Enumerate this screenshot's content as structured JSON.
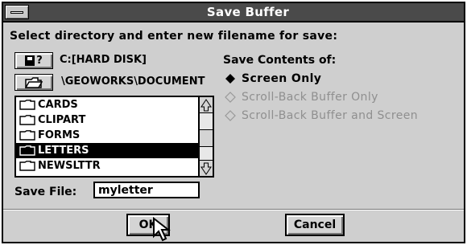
{
  "window": {
    "title": "Save Buffer"
  },
  "instructions": "Select directory and enter new filename for save:",
  "drive": {
    "button_label": "?",
    "label": "C:[HARD DISK]"
  },
  "path": {
    "label": "\\GEOWORKS\\DOCUMENT"
  },
  "file_list": {
    "items": [
      {
        "label": "CARDS",
        "selected": false
      },
      {
        "label": "CLIPART",
        "selected": false
      },
      {
        "label": "FORMS",
        "selected": false
      },
      {
        "label": "LETTERS",
        "selected": true
      },
      {
        "label": "NEWSLTTR",
        "selected": false
      }
    ]
  },
  "save_file": {
    "label": "Save File:",
    "value": "myletter"
  },
  "save_contents": {
    "label": "Save Contents of:",
    "options": [
      {
        "label": "Screen Only",
        "selected": true,
        "enabled": true
      },
      {
        "label": "Scroll-Back Buffer Only",
        "selected": false,
        "enabled": false
      },
      {
        "label": "Scroll-Back Buffer and Screen",
        "selected": false,
        "enabled": false
      }
    ]
  },
  "buttons": {
    "ok": "OK",
    "cancel": "Cancel"
  }
}
